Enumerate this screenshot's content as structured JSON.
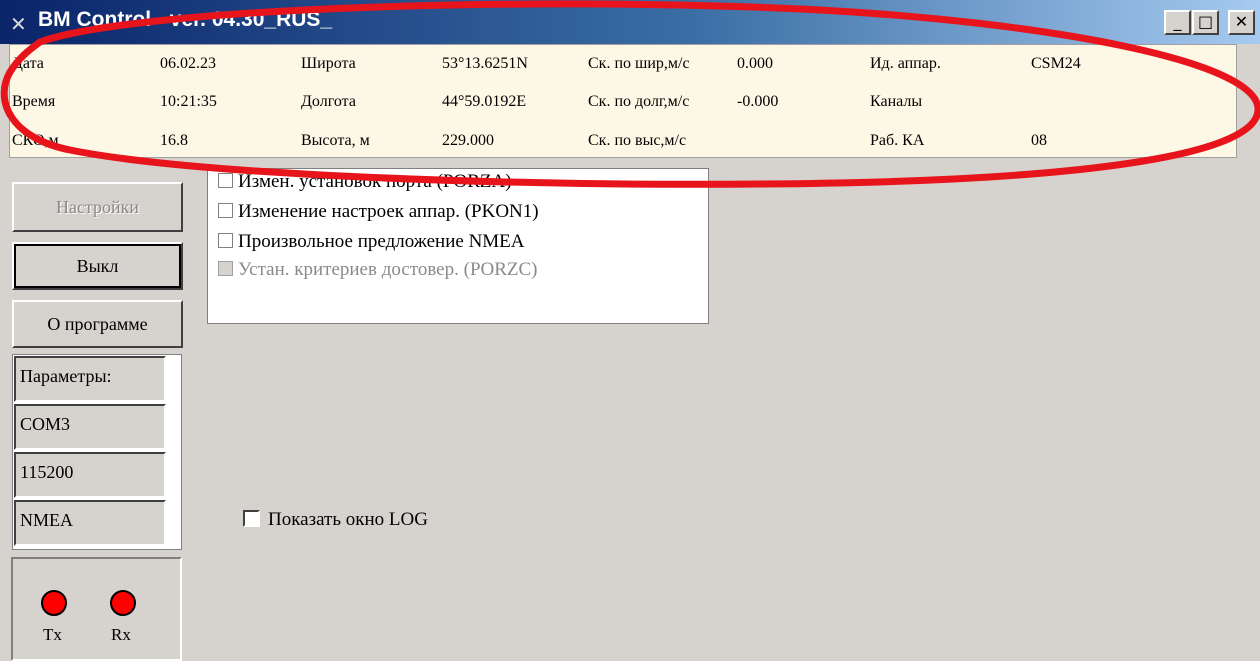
{
  "window": {
    "title": "BM Control - ver. 04.30_RUS_",
    "app_icon": "satellite-icon",
    "controls": [
      "minimize",
      "maximize",
      "close"
    ]
  },
  "info": {
    "date_label": "Дата",
    "date_value": "06.02.23",
    "time_label": "Время",
    "time_value": "10:21:35",
    "sko_label": "СКО,м",
    "sko_value": "16.8",
    "lat_label": "Широта",
    "lat_value": "53°13.6251N",
    "lon_label": "Долгота",
    "lon_value": "44°59.0192E",
    "alt_label": "Высота, м",
    "alt_value": "229.000",
    "spd_lat_label": "Ск. по шир,м/с",
    "spd_lat_value": "0.000",
    "spd_lon_label": "Ск. по долг,м/с",
    "spd_lon_value": "-0.000",
    "spd_alt_label": "Ск. по выс,м/с",
    "device_id_label": "Ид. аппар.",
    "device_id_value": "CSM24",
    "channels_label": "Каналы",
    "sats_label": "Раб. КА",
    "sats_value": "08"
  },
  "buttons": {
    "settings": "Настройки",
    "off": "Выкл",
    "about": "О программе"
  },
  "params": {
    "header": "Параметры:",
    "port": "COM3",
    "baud": "115200",
    "protocol": "NMEA"
  },
  "checklist": [
    {
      "label": "Измен. установок порта (PORZA)",
      "checked": false,
      "enabled": true
    },
    {
      "label": "Изменение настроек аппар. (PKON1)",
      "checked": false,
      "enabled": true
    },
    {
      "label": "Произвольное предложение NMEA",
      "checked": false,
      "enabled": true
    },
    {
      "label": "Устан. критериев достовер. (PORZC)",
      "checked": false,
      "enabled": false
    }
  ],
  "leds": {
    "tx_label": "Tx",
    "rx_label": "Rx",
    "color": "#ff0000"
  },
  "log": {
    "label": "Показать окно LOG",
    "checked": false
  },
  "annotation": {
    "color": "#e8141c",
    "shape": "hand-drawn ellipse"
  }
}
